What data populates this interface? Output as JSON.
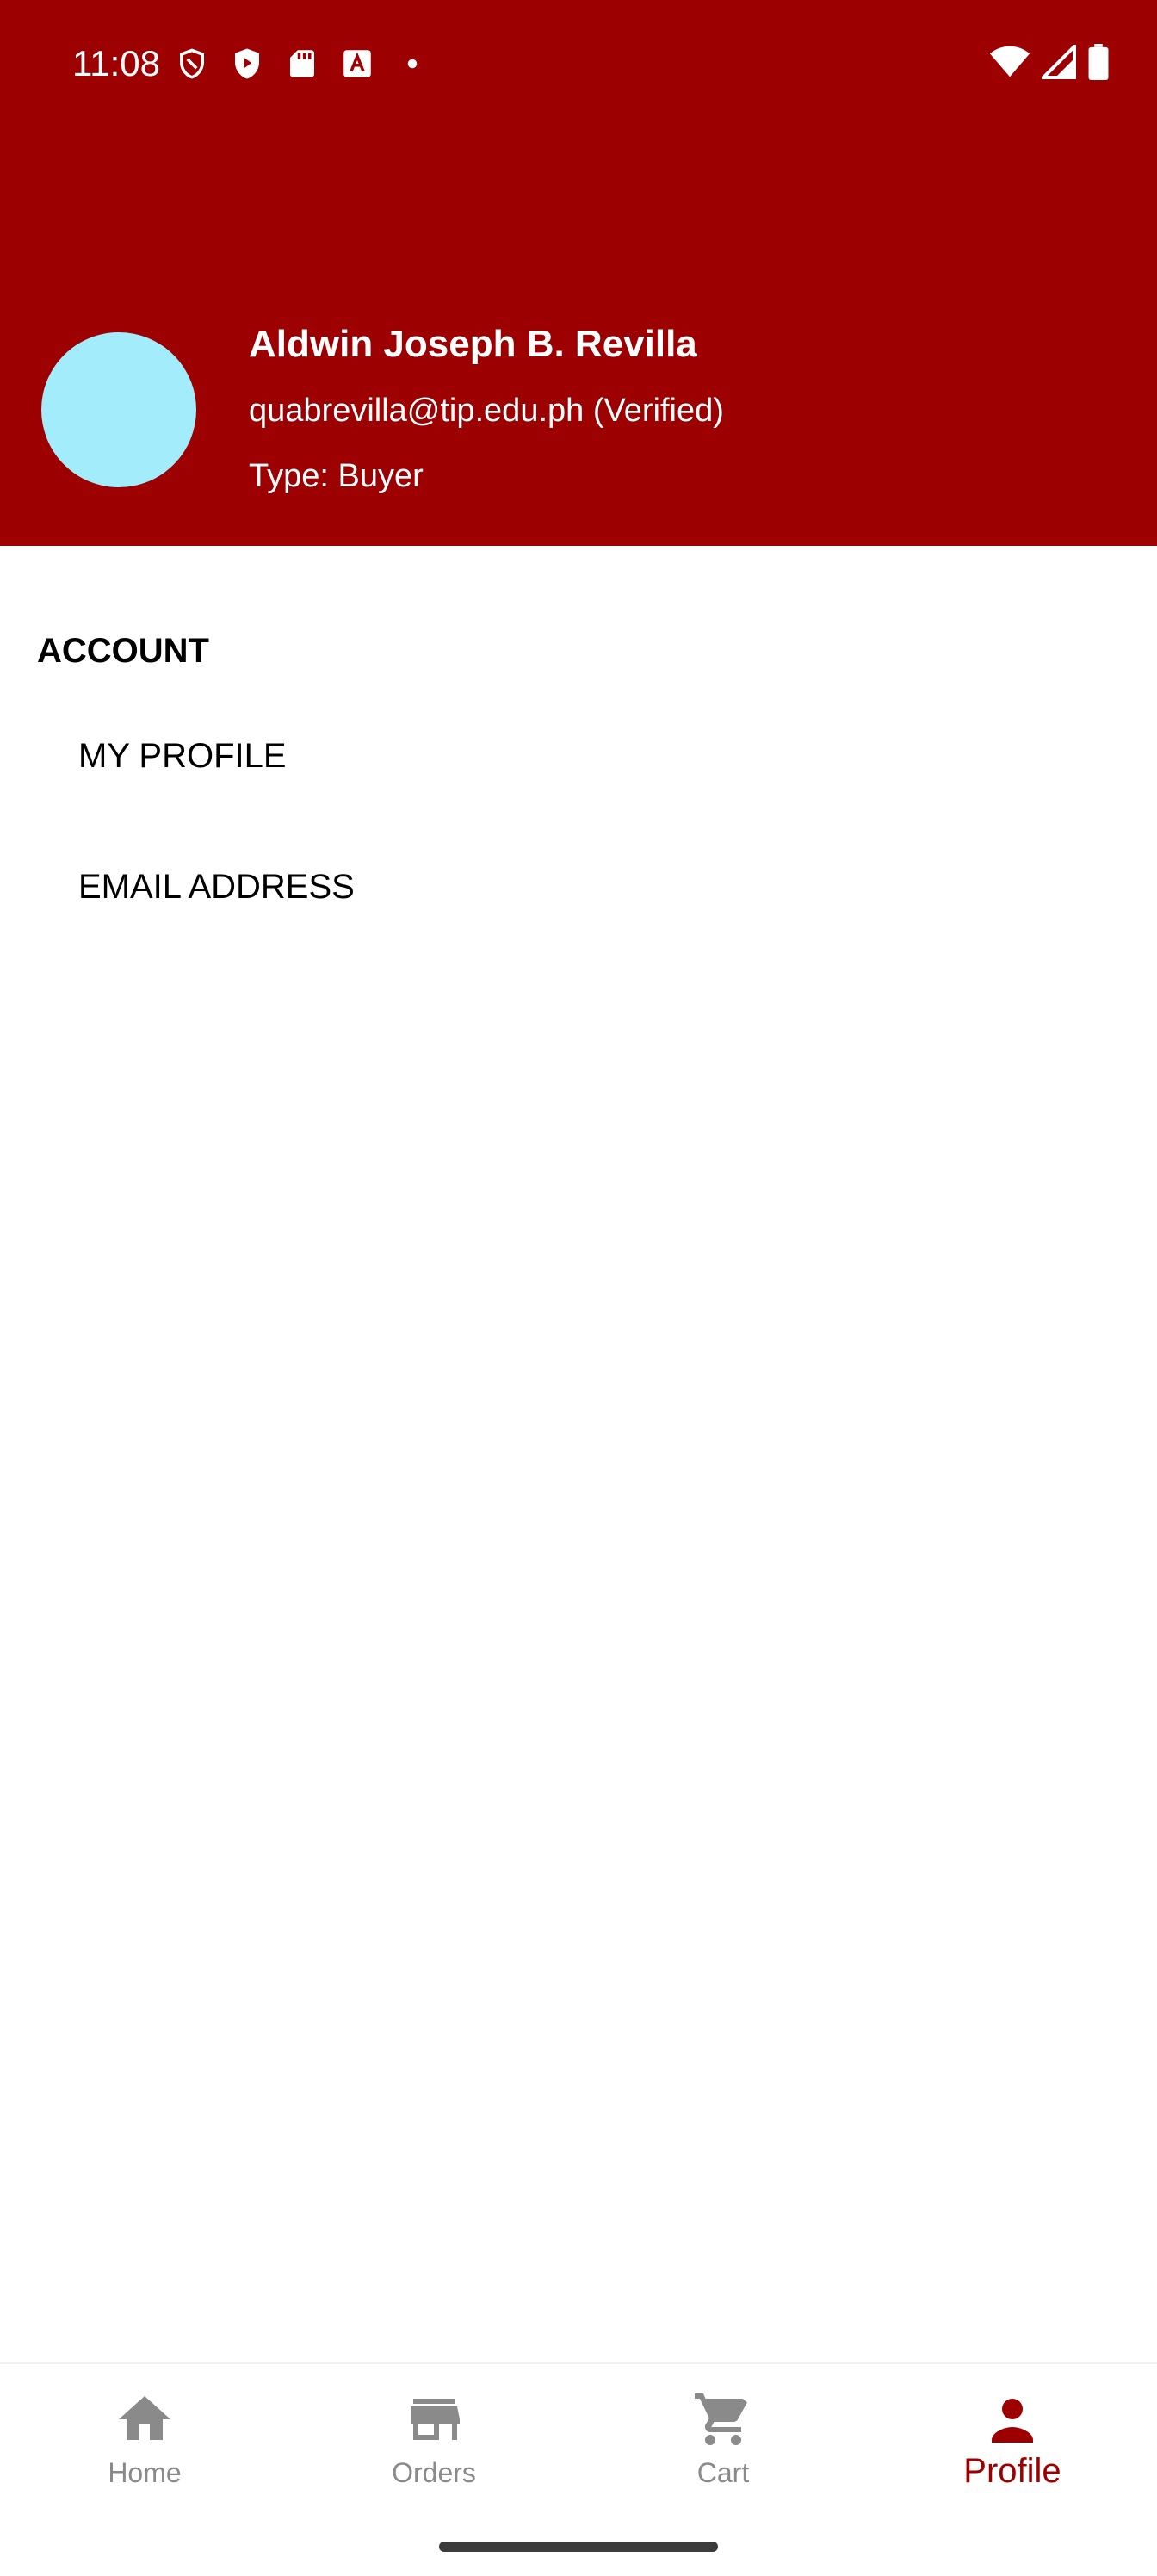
{
  "status_bar": {
    "time": "11:08",
    "left_icons": [
      "shield-outline-icon",
      "shield-play-icon",
      "sd-card-icon",
      "app-a-icon",
      "dot-icon"
    ],
    "right_icons": [
      "wifi-icon",
      "signal-icon",
      "battery-icon"
    ]
  },
  "header": {
    "background_color": "#9c0000",
    "avatar_color": "#a2ecfb",
    "name": "Aldwin Joseph B. Revilla",
    "email": "quabrevilla@tip.edu.ph (Verified)",
    "type": "Type: Buyer"
  },
  "account": {
    "title": "ACCOUNT",
    "items": [
      {
        "label": "MY PROFILE"
      },
      {
        "label": "EMAIL ADDRESS"
      }
    ]
  },
  "bottom_nav": {
    "active_color": "#9c0000",
    "inactive_color": "#8a8a8a",
    "items": [
      {
        "label": "Home",
        "icon": "home-icon",
        "active": false
      },
      {
        "label": "Orders",
        "icon": "store-icon",
        "active": false
      },
      {
        "label": "Cart",
        "icon": "cart-icon",
        "active": false
      },
      {
        "label": "Profile",
        "icon": "person-icon",
        "active": true
      }
    ]
  }
}
